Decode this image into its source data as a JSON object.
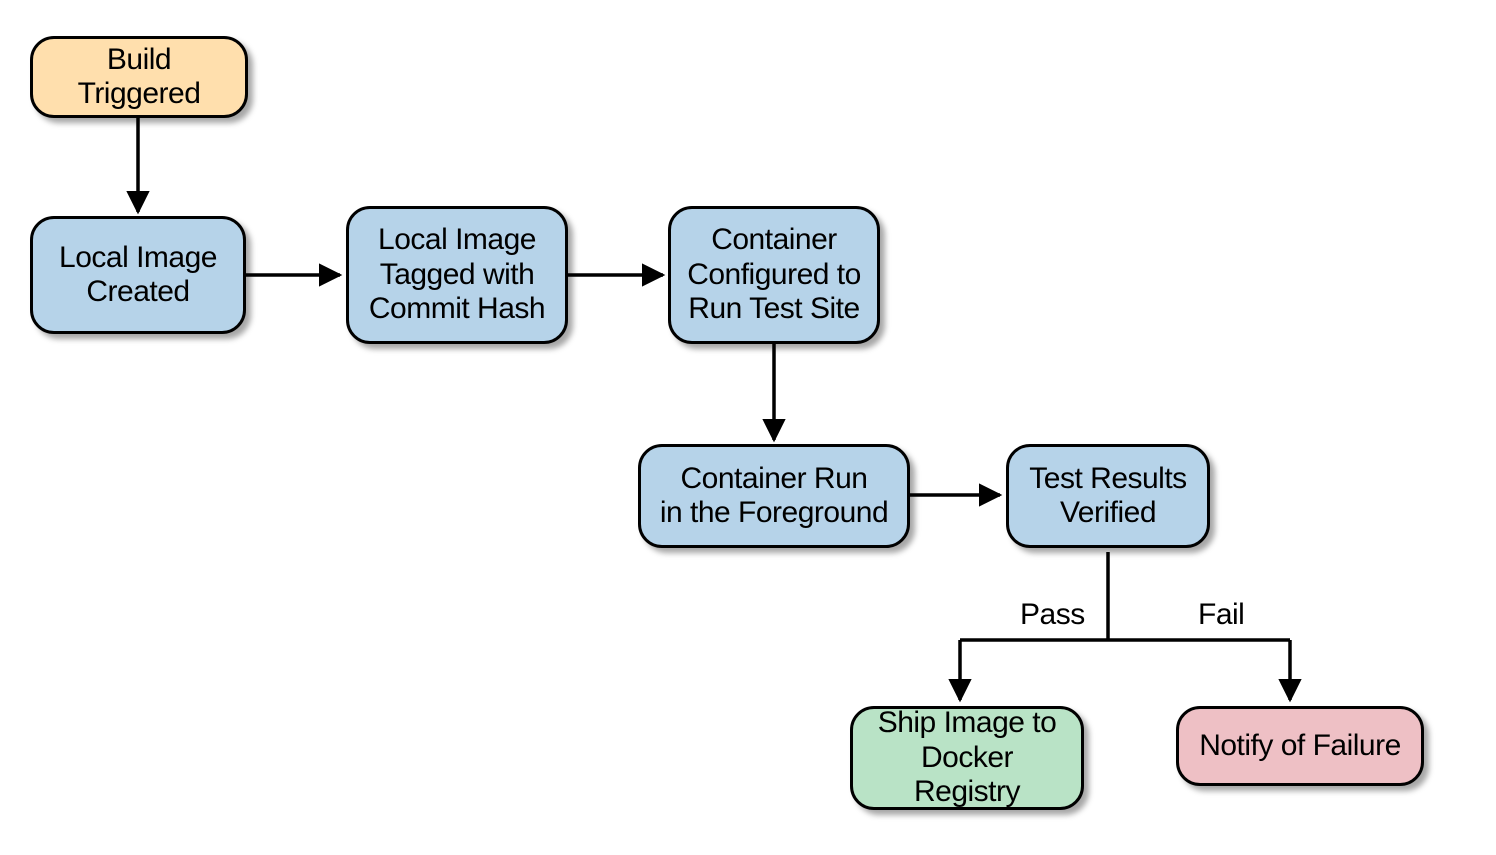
{
  "nodes": {
    "build_triggered": "Build Triggered",
    "local_image": "Local Image\nCreated",
    "tagged": "Local Image\nTagged with\nCommit Hash",
    "configured": "Container\nConfigured to\nRun Test Site",
    "run_fg": "Container Run\nin the Foreground",
    "verified": "Test Results\nVerified",
    "ship": "Ship Image to\nDocker Registry",
    "notify": "Notify of Failure"
  },
  "edge_labels": {
    "pass": "Pass",
    "fail": "Fail"
  },
  "colors": {
    "start": "#ffdfad",
    "process": "#b6d3e9",
    "pass": "#b9e3c6",
    "fail": "#eec0c5"
  }
}
